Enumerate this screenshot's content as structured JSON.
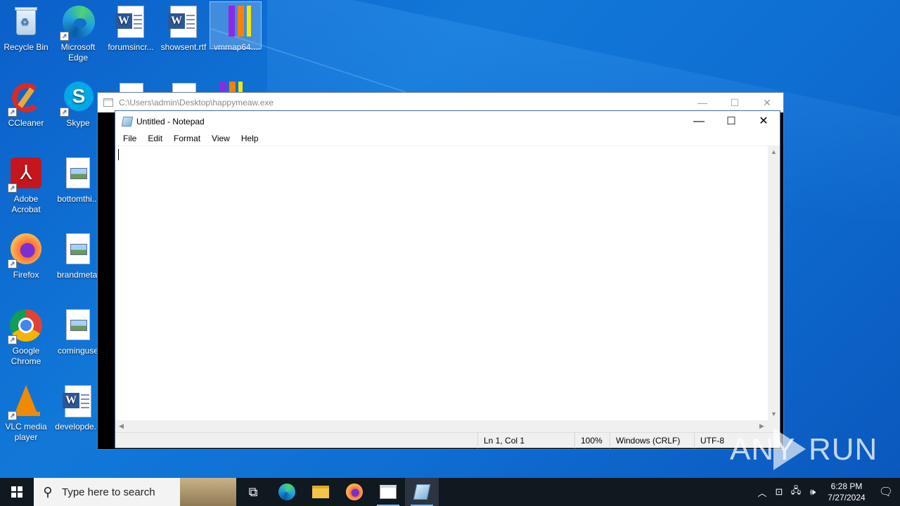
{
  "desktop": {
    "icons": [
      {
        "label": "Recycle Bin"
      },
      {
        "label": "Microsoft Edge"
      },
      {
        "label": "forumsincr..."
      },
      {
        "label": "showsent.rtf"
      },
      {
        "label": "vmmap64...."
      },
      {
        "label": "CCleaner"
      },
      {
        "label": "Skype"
      },
      {
        "label": "Adobe Acrobat"
      },
      {
        "label": "bottomthi..."
      },
      {
        "label": "Firefox"
      },
      {
        "label": "brandmetal"
      },
      {
        "label": "Google Chrome"
      },
      {
        "label": "cominguse"
      },
      {
        "label": "VLC media player"
      },
      {
        "label": "developde..."
      }
    ]
  },
  "back_window": {
    "title": "C:\\Users\\admin\\Desktop\\happymeaw.exe"
  },
  "notepad": {
    "title": "Untitled - Notepad",
    "menu": [
      "File",
      "Edit",
      "Format",
      "View",
      "Help"
    ],
    "content": "",
    "status": {
      "position": "Ln 1, Col 1",
      "zoom": "100%",
      "line_ending": "Windows (CRLF)",
      "encoding": "UTF-8"
    }
  },
  "watermark": {
    "left": "ANY",
    "right": "RUN"
  },
  "taskbar": {
    "search_placeholder": "Type here to search",
    "time": "6:28 PM",
    "date": "7/27/2024"
  }
}
